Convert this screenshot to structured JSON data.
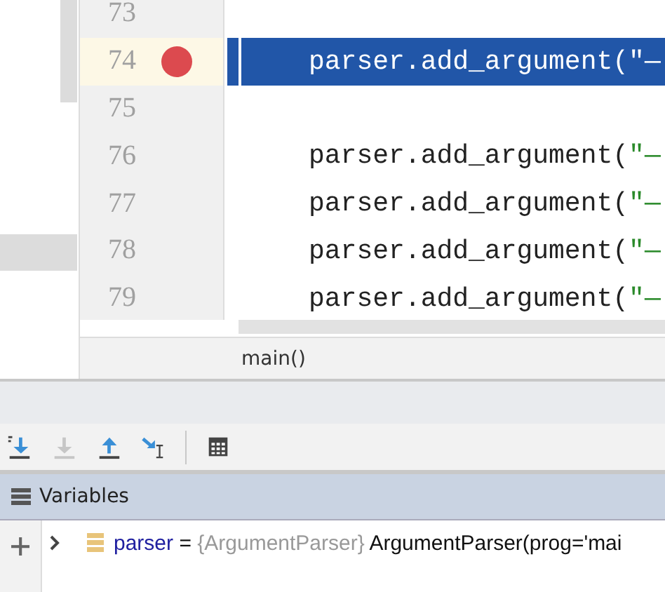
{
  "editor": {
    "lines": [
      {
        "number": "73",
        "breakpoint": false,
        "current": false
      },
      {
        "number": "74",
        "code": "parser.add_argument(",
        "string": "″—",
        "breakpoint": true,
        "current": true
      },
      {
        "number": "75",
        "breakpoint": false,
        "current": false
      },
      {
        "number": "76",
        "code": "parser.add_argument(",
        "string": "″—",
        "breakpoint": false,
        "current": false
      },
      {
        "number": "77",
        "code": "parser.add_argument(",
        "string": "″—",
        "breakpoint": false,
        "current": false
      },
      {
        "number": "78",
        "code": "parser.add_argument(",
        "string": "″—",
        "breakpoint": false,
        "current": false
      },
      {
        "number": "79",
        "code": "parser.add_argument(",
        "string": "″—",
        "breakpoint": false,
        "current": false
      }
    ],
    "breadcrumb": "main()"
  },
  "toolbar": [
    {
      "kind": "step-over",
      "disabled": false
    },
    {
      "kind": "step-into",
      "disabled": true
    },
    {
      "kind": "step-out",
      "disabled": false
    },
    {
      "kind": "run-to-cursor",
      "disabled": false
    },
    {
      "kind": "separator"
    },
    {
      "kind": "evaluate",
      "disabled": false
    }
  ],
  "variables": {
    "title": "Variables",
    "rows": [
      {
        "name": "parser",
        "operator": "=",
        "type": "{ArgumentParser}",
        "value": "ArgumentParser(prog='mai"
      }
    ]
  }
}
